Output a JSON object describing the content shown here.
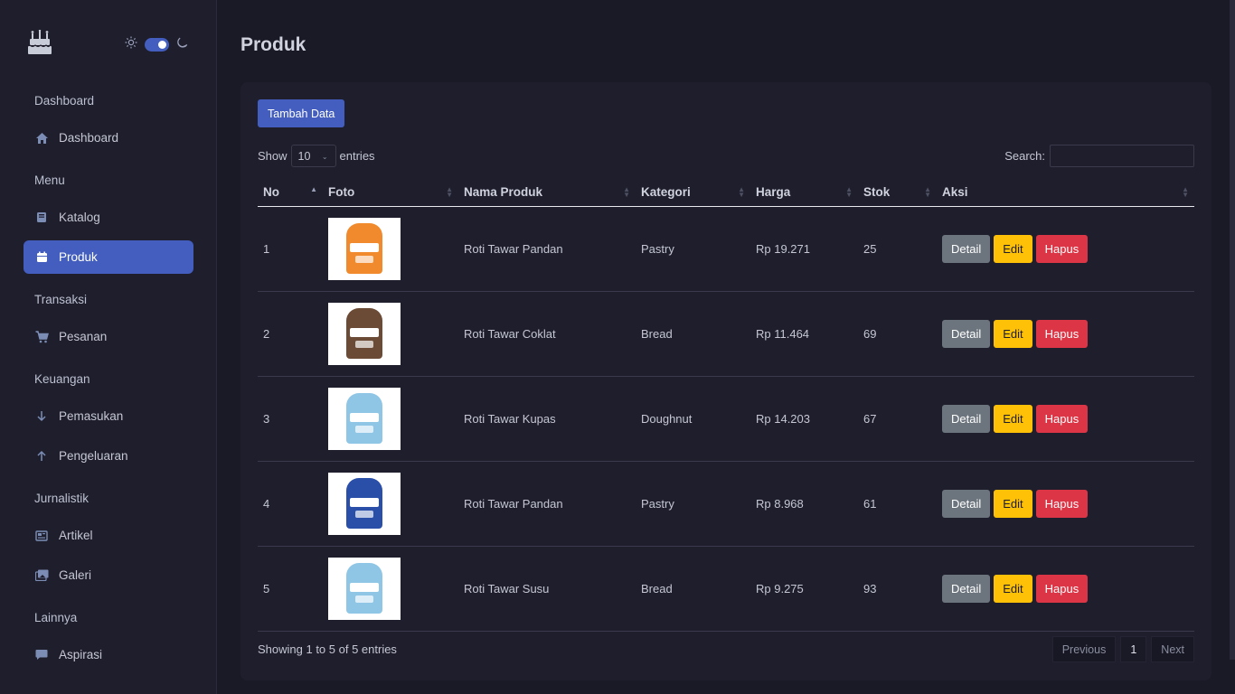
{
  "sidebar": {
    "sections": [
      {
        "title": "Dashboard",
        "items": [
          {
            "label": "Dashboard",
            "icon": "house-icon"
          }
        ]
      },
      {
        "title": "Menu",
        "items": [
          {
            "label": "Katalog",
            "icon": "book-icon"
          },
          {
            "label": "Produk",
            "icon": "calendar-icon",
            "active": true
          }
        ]
      },
      {
        "title": "Transaksi",
        "items": [
          {
            "label": "Pesanan",
            "icon": "cart-icon"
          }
        ]
      },
      {
        "title": "Keuangan",
        "items": [
          {
            "label": "Pemasukan",
            "icon": "arrow-down-icon"
          },
          {
            "label": "Pengeluaran",
            "icon": "arrow-up-icon"
          }
        ]
      },
      {
        "title": "Jurnalistik",
        "items": [
          {
            "label": "Artikel",
            "icon": "newspaper-icon"
          },
          {
            "label": "Galeri",
            "icon": "images-icon"
          }
        ]
      },
      {
        "title": "Lainnya",
        "items": [
          {
            "label": "Aspirasi",
            "icon": "chat-icon"
          }
        ]
      }
    ]
  },
  "page": {
    "title": "Produk"
  },
  "toolbar": {
    "add_label": "Tambah Data"
  },
  "length": {
    "show_label": "Show",
    "value": "10",
    "entries_label": "entries"
  },
  "search": {
    "label": "Search:",
    "placeholder": ""
  },
  "table": {
    "headers": [
      "No",
      "Foto",
      "Nama Produk",
      "Kategori",
      "Harga",
      "Stok",
      "Aksi"
    ],
    "actions": {
      "detail": "Detail",
      "edit": "Edit",
      "delete": "Hapus"
    },
    "rows": [
      {
        "no": "1",
        "name": "Roti Tawar Pandan",
        "category": "Pastry",
        "price": "Rp 19.271",
        "stock": "25",
        "photo_color": "#f08a2c"
      },
      {
        "no": "2",
        "name": "Roti Tawar Coklat",
        "category": "Bread",
        "price": "Rp 11.464",
        "stock": "69",
        "photo_color": "#6b4a36"
      },
      {
        "no": "3",
        "name": "Roti Tawar Kupas",
        "category": "Doughnut",
        "price": "Rp 14.203",
        "stock": "67",
        "photo_color": "#8fc6e6"
      },
      {
        "no": "4",
        "name": "Roti Tawar Pandan",
        "category": "Pastry",
        "price": "Rp 8.968",
        "stock": "61",
        "photo_color": "#2a4fa8"
      },
      {
        "no": "5",
        "name": "Roti Tawar Susu",
        "category": "Bread",
        "price": "Rp 9.275",
        "stock": "93",
        "photo_color": "#8fc6e6"
      }
    ]
  },
  "footer": {
    "info": "Showing 1 to 5 of 5 entries",
    "previous": "Previous",
    "page": "1",
    "next": "Next"
  },
  "colors": {
    "primary": "#435ebe",
    "warning": "#ffc107",
    "danger": "#dc3545",
    "secondary": "#6c757d"
  }
}
